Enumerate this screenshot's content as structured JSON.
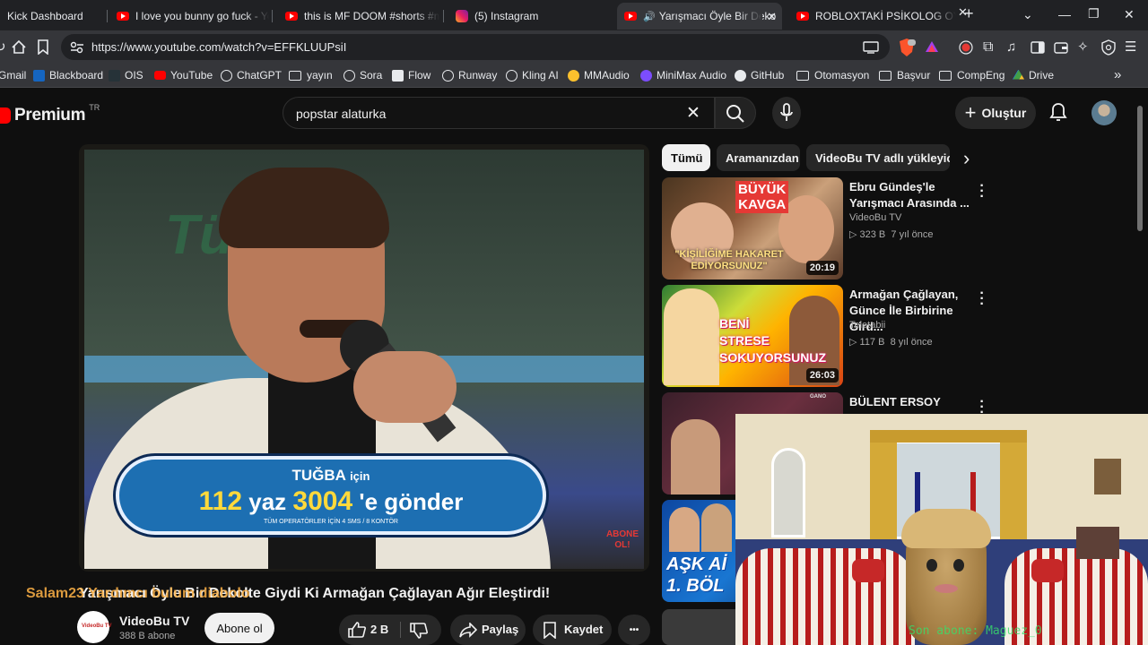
{
  "browser": {
    "tabs": [
      {
        "title": "Kick Dashboard",
        "icon": "none",
        "active": false
      },
      {
        "title": "I love you bunny go fuck - You",
        "icon": "youtube",
        "active": false
      },
      {
        "title": "this is MF DOOM #shorts #mem",
        "icon": "youtube",
        "active": false
      },
      {
        "title": "(5) Instagram",
        "icon": "instagram",
        "active": false
      },
      {
        "title": "Yarışmacı Öyle Bir Deko",
        "icon": "youtube",
        "active": true
      },
      {
        "title": "ROBLOXTAKİ PSİKOLOG OYUNI",
        "icon": "youtube",
        "active": false
      }
    ],
    "new_tab": "+",
    "url": "https://www.youtube.com/watch?v=EFFKLUUPsiI",
    "bookmarks": [
      "Gmail",
      "Blackboard",
      "OIS",
      "YouTube",
      "ChatGPT",
      "yayın",
      "Sora",
      "Flow",
      "Runway",
      "Kling AI",
      "MMAudio",
      "MiniMax Audio",
      "GitHub",
      "Otomasyon",
      "Başvur",
      "CompEng",
      "Drive"
    ],
    "more_bookmarks": "»"
  },
  "youtube": {
    "logo_text": "Premium",
    "country_code": "TR",
    "search_value": "popstar alaturka",
    "create_label": "Oluştur",
    "video": {
      "title": "Yarışmacı Öyle Bir Dekolte Giydi Ki Armağan Çağlayan Ağır Eleştirdi!",
      "overlay_text": "Salam23 Yardımcı bulum diabolo",
      "banner_line1": "TUĞBA",
      "banner_line1_small": "için",
      "banner_num1": "112",
      "banner_word": "yaz",
      "banner_num2": "3004",
      "banner_tail": "'e gönder",
      "banner_line3": "TÜM OPERATÖRLER İÇİN 4 SMS / 8 KONTÖR",
      "bg_word": "Tüm",
      "corner_badge": "ABONE OL!"
    },
    "channel": {
      "name": "VideoBu TV",
      "subscribers": "388 B abone",
      "subscribe_label": "Abone ol",
      "logo_text": "VideoBu TV"
    },
    "actions": {
      "likes": "2 B",
      "share": "Paylaş",
      "save": "Kaydet",
      "more": "•••"
    },
    "chips": [
      "Tümü",
      "Aramanızdan",
      "VideoBu TV adlı yükleyiciden"
    ],
    "related": [
      {
        "title": "Ebru Gündeş'le\nYarışmacı Arasında ...",
        "channel": "VideoBu TV",
        "views": "323 B",
        "age": "7 yıl önce",
        "duration": "20:19",
        "thumb_text_top": "BÜYÜK\nKAVGA",
        "thumb_text_bottom": "\"KİŞİLİĞİME HAKARET\nEDİYORSUNUZ\""
      },
      {
        "title": "Armağan Çağlayan,\nGünce İle Birbirine Gird...",
        "channel": "Teletabii",
        "views": "117 B",
        "age": "8 yıl önce",
        "duration": "26:03",
        "thumb_text": "BENİ\nSTRESE\nSOKUYORSUNUZ"
      },
      {
        "title": "BÜLENT ERSOY AFYON",
        "thumb_text": "GANO"
      },
      {
        "thumb_text": "AŞK Aİ\n1. BÖL"
      }
    ]
  },
  "webcam": {
    "caption": "Son abone: Maguez_0"
  }
}
